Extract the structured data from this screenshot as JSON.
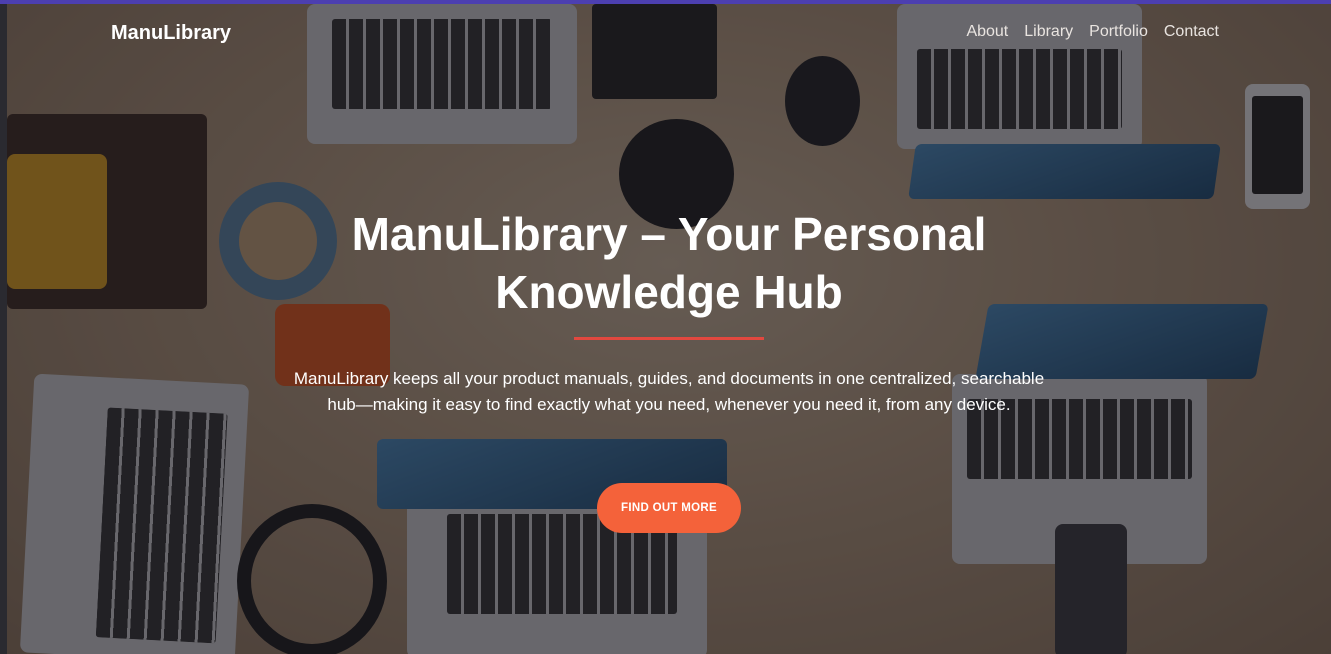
{
  "nav": {
    "brand": "ManuLibrary",
    "links": [
      "About",
      "Library",
      "Portfolio",
      "Contact"
    ]
  },
  "hero": {
    "title": "ManuLibrary – Your Personal Knowledge Hub",
    "lead": "ManuLibrary keeps all your product manuals, guides, and documents in one centralized, searchable hub—making it easy to find exactly what you need, whenever you need it, from any device.",
    "cta_label": "FIND OUT MORE",
    "background": "desk with laptops photo"
  },
  "colors": {
    "accent": "#f4623a",
    "divider": "#e2483f",
    "top_border": "#4c3fb0"
  }
}
